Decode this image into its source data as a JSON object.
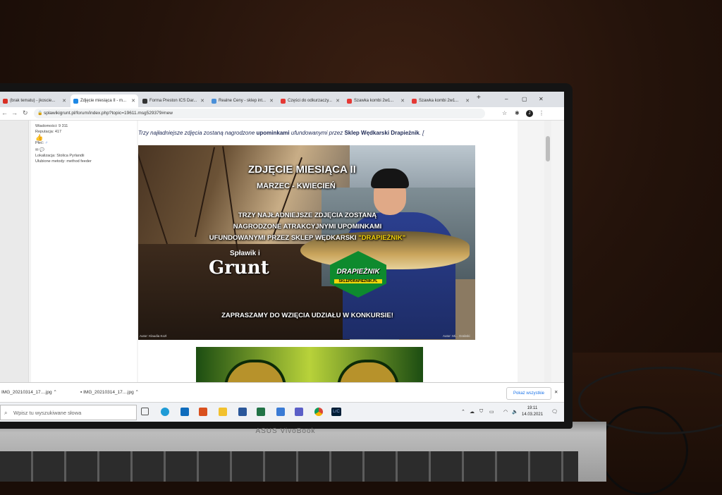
{
  "tabs": [
    {
      "label": "(brak tematu) - jkoscie...",
      "icon_color": "#d93025"
    },
    {
      "label": "Zdjęcie miesiąca II - m...",
      "icon_color": "#1e88e5"
    },
    {
      "label": "Forma Preston ICS Dar...",
      "icon_color": "#333333"
    },
    {
      "label": "Realne Ceny - sklep int...",
      "icon_color": "#4a90d9"
    },
    {
      "label": "Części do odkurzaczy...",
      "icon_color": "#e53935"
    },
    {
      "label": "Szawka kombi 2w1...",
      "icon_color": "#e53935"
    },
    {
      "label": "Szawka kombi 2w1...",
      "icon_color": "#e53935"
    }
  ],
  "address": {
    "url": "splawikigrunt.pl/forum/index.php?topic=19611.msg529379#new",
    "avatar_letter": "J"
  },
  "profile": {
    "wiadomosci_label": "Wiadomości:",
    "wiadomosci": "9 311",
    "reputacja_label": "Reputacja:",
    "reputacja": "417",
    "plec_label": "Płeć:",
    "plec_icon": "♂",
    "lokalizacja_label": "Lokalizacja:",
    "lokalizacja": "Stolica Pyrlandii",
    "metody_label": "Ulubione metody:",
    "metody": "method feeder"
  },
  "post": {
    "intro_pre": "Trzy najładniejsze zdjęcia zostaną nagrodzone ",
    "intro_bold1": "upominkami",
    "intro_mid": " ufundowanymi przez ",
    "intro_bold2": "Sklep Wędkarski Drapieżnik",
    "intro_post": ". [",
    "hero": {
      "title": "ZDJĘCIE MIESIĄCA II",
      "subtitle": "MARZEC - KWIECIEŃ",
      "line1": "TRZY NAJŁADNIEJSZE ZDJĘCIA ZOSTANĄ",
      "line2": "NAGRODZONE ATRAKCYJNYMI UPOMINKAMI",
      "line3_pre": "UFUNDOWANYMI PRZEZ SKLEP WĘDKARSKI ",
      "line3_hl": "\"DRAPIEŻNIK\"",
      "cta": "ZAPRASZAMY DO WZIĘCIA UDZIAŁU W KONKURSIE!",
      "logo_a": "Spławik i",
      "logo_b": "Grunt",
      "badge_1": "DRAPIEŻNIK",
      "badge_2": "SKLEPDRAPIEZNIK.PL",
      "credit_left": "Autor: Klaudia Kozł",
      "credit_right": "Autor: Mi... Grabski"
    }
  },
  "downloads": {
    "item1": "IMG_20210314_17....jpg",
    "item2": "IMG_20210314_17....jpg",
    "show_all": "Pokaż wszystkie"
  },
  "taskbar": {
    "search_placeholder": "Wpisz tu wyszukiwane słowa",
    "lrc_label": "LrC",
    "time": "19:11",
    "date": "14.03.2021"
  },
  "laptop_brand": "ASUS VivoBook"
}
